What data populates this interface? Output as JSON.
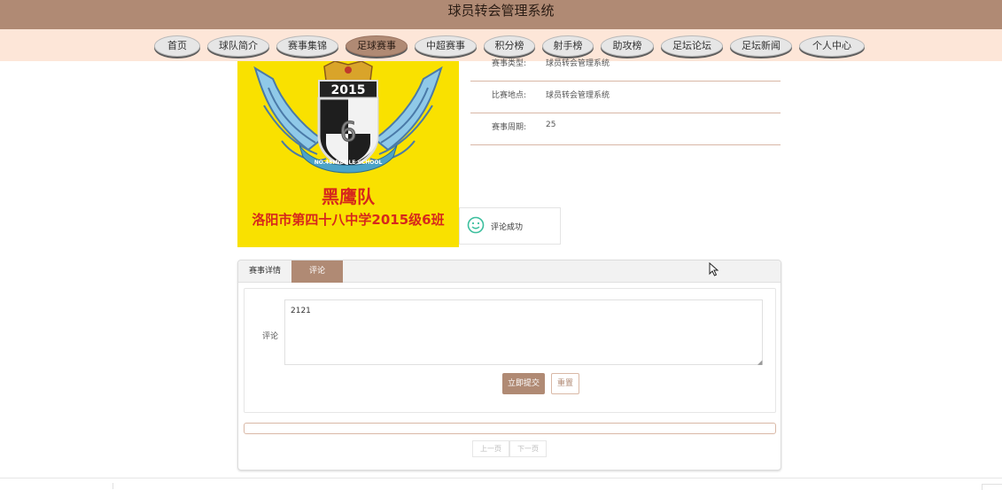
{
  "header": {
    "title": "球员转会管理系统"
  },
  "nav": {
    "items": [
      {
        "label": "首页"
      },
      {
        "label": "球队简介"
      },
      {
        "label": "赛事集锦"
      },
      {
        "label": "足球赛事"
      },
      {
        "label": "中超赛事"
      },
      {
        "label": "积分榜"
      },
      {
        "label": "射手榜"
      },
      {
        "label": "助攻榜"
      },
      {
        "label": "足坛论坛"
      },
      {
        "label": "足坛新闻"
      },
      {
        "label": "个人中心"
      }
    ],
    "active": "足球赛事"
  },
  "logo": {
    "year": "2015",
    "team_name": "黑鹰队",
    "school_line": "洛阳市第四十八中学2015级6班",
    "badge_ring_text": "NO.48MIDDLE SCHOOL",
    "background": "#f9e100"
  },
  "details": {
    "rows": [
      {
        "label": "赛事类型:",
        "value": "球员转会管理系统"
      },
      {
        "label": "比赛地点:",
        "value": "球员转会管理系统"
      },
      {
        "label": "赛事周期:",
        "value": "25"
      }
    ]
  },
  "toast": {
    "icon": "smile-icon",
    "text": "评论成功"
  },
  "tabs": [
    {
      "label": "赛事详情"
    },
    {
      "label": "评论"
    }
  ],
  "comment_form": {
    "label": "评论",
    "value": "2121",
    "submit_label": "立即提交",
    "reset_label": "重置"
  },
  "pagination": {
    "prev_label": "上一页",
    "next_label": "下一页"
  },
  "colors": {
    "brand": "#b08a74",
    "nav_bg": "#fde6d8",
    "toast_icon": "#3cbf9e"
  }
}
